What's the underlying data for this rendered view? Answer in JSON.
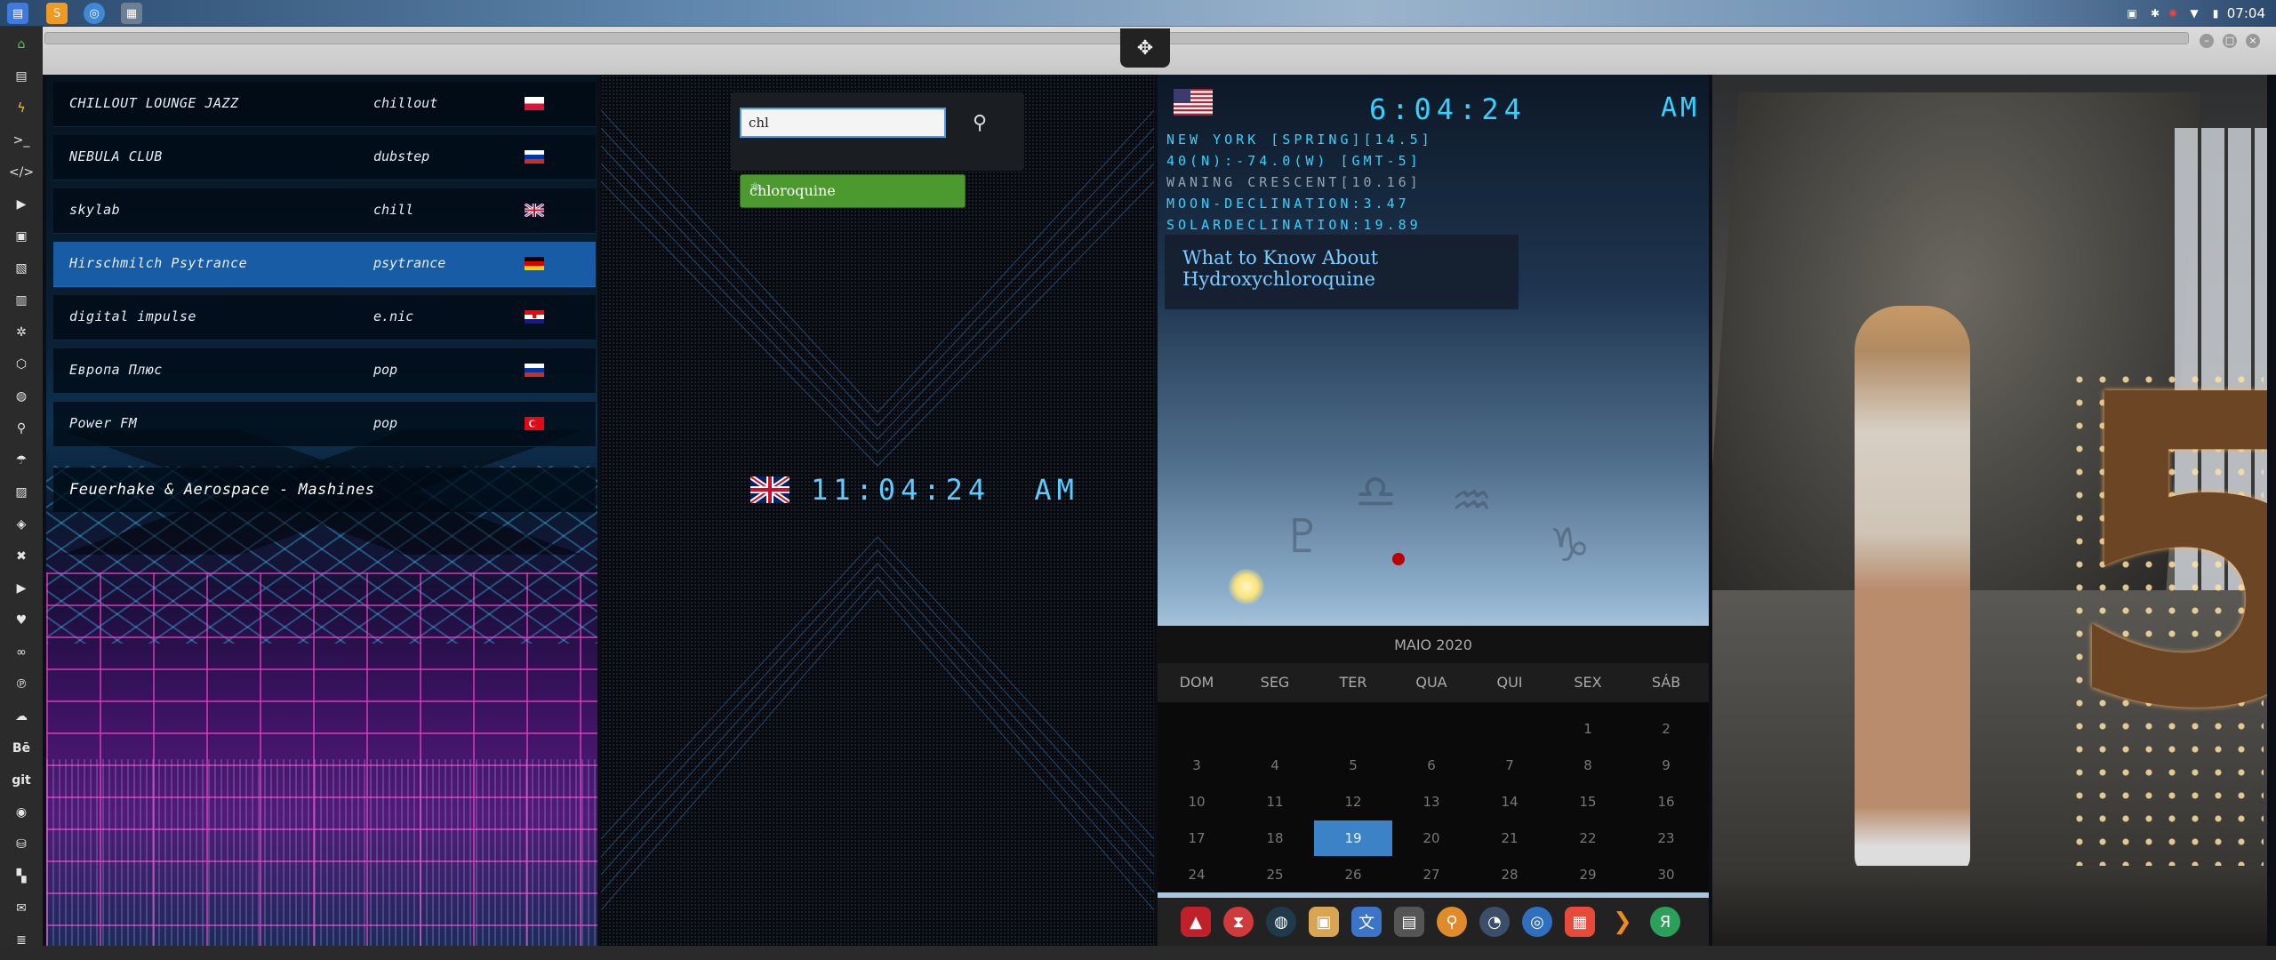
{
  "system_bar": {
    "clock": "07:04",
    "apps": [
      "files-app",
      "sublime-app",
      "chrome-app",
      "workspace-app"
    ],
    "tray": [
      "image-icon",
      "bluetooth-icon",
      "debian-icon",
      "wifi-icon",
      "battery-icon"
    ]
  },
  "left_dock": {
    "items": [
      "home-icon",
      "document-icon",
      "lightning-icon",
      "terminal-icon",
      "code-icon",
      "play-icon",
      "video-icon",
      "image-icon",
      "newspaper-icon",
      "settings-icon",
      "hexagon-icon",
      "globe-icon",
      "search-icon",
      "umbrella-icon",
      "contact-icon",
      "tag-icon",
      "tools-icon",
      "youtube-icon",
      "heart-icon",
      "lastfm-icon",
      "pinterest-icon",
      "cloud-icon",
      "behance-icon",
      "git-icon",
      "github-icon",
      "bitbucket-icon",
      "map-icon",
      "mail-icon",
      "list-icon"
    ],
    "labels": {
      "behance": "Bē",
      "git": "git"
    }
  },
  "radio": {
    "stations": [
      {
        "name": "CHILLOUT LOUNGE JAZZ",
        "genre": "chillout",
        "flag": "pl",
        "active": false
      },
      {
        "name": "NEBULA CLUB",
        "genre": "dubstep",
        "flag": "ru",
        "active": false
      },
      {
        "name": "skylab",
        "genre": "chill",
        "flag": "gb",
        "active": false
      },
      {
        "name": "Hirschmilch Psytrance",
        "genre": "psytrance",
        "flag": "de",
        "active": true
      },
      {
        "name": "digital impulse",
        "genre": "e.nic",
        "flag": "hr",
        "active": false
      },
      {
        "name": "Европа Плюс",
        "genre": "pop",
        "flag": "ru",
        "active": false
      },
      {
        "name": "Power FM",
        "genre": "pop",
        "flag": "tr",
        "active": false
      }
    ],
    "now_playing": "Feuerhake & Aerospace - Mashines"
  },
  "search": {
    "value": "chl",
    "suggestion": "chloroquine"
  },
  "uk_clock": {
    "time": "11:04:24",
    "ampm": "AM"
  },
  "ny": {
    "time": "6:04:24",
    "ampm": "AM",
    "lines": [
      "NEW YORK [SPRING][14.5]",
      "40(N):-74.0(W) [GMT-5]",
      "WANING CRESCENT[10.16]",
      "MOON-DECLINATION:3.47",
      "SOLARDECLINATION:19.89"
    ],
    "news": "What to Know About Hydroxychloroquine"
  },
  "calendar": {
    "month": "MAIO 2020",
    "dows": [
      "DOM",
      "SEG",
      "TER",
      "QUA",
      "QUI",
      "SEX",
      "SÁB"
    ],
    "rows": [
      [
        "",
        "",
        "",
        "",
        "",
        "1",
        "2"
      ],
      [
        "3",
        "4",
        "5",
        "6",
        "7",
        "8",
        "9"
      ],
      [
        "10",
        "11",
        "12",
        "13",
        "14",
        "15",
        "16"
      ],
      [
        "17",
        "18",
        "19",
        "20",
        "21",
        "22",
        "23"
      ],
      [
        "24",
        "25",
        "26",
        "27",
        "28",
        "29",
        "30"
      ]
    ],
    "today": "19"
  },
  "dock": {
    "items": [
      "arrow-app-icon",
      "hourglass-icon",
      "earth-icon",
      "photos-icon",
      "translate-icon",
      "news-icon",
      "search-app-icon",
      "clock-app-icon",
      "globe-app-icon",
      "calendar-app-icon",
      "play-app-icon",
      "yandex-icon"
    ],
    "yandex_label": "Я"
  },
  "colors": {
    "accent": "#3c82c7",
    "clock_cyan": "#35d1ff",
    "suggest_green": "#4c9a2f",
    "neon_pink": "#ff46d2"
  }
}
